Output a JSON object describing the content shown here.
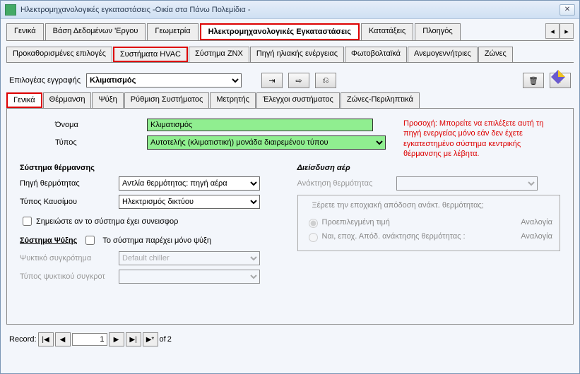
{
  "window": {
    "title": "Ηλεκτρομηχανολογικές εγκαταστάσεις -Οικία στα Πάνω Πολεμίδια -"
  },
  "tabs_main": [
    "Γενικά",
    "Βάση Δεδομένων 'Εργου",
    "Γεωμετρία",
    "Ηλεκτρομηχανολογικές Εγκαταστάσεις",
    "Κατατάξεις",
    "Πλοηγός"
  ],
  "tabs_main_active": 3,
  "tabs_sub": [
    "Προκαθορισμένες επιλογές",
    "Συστήματα HVAC",
    "Σύστημα ZNX",
    "Πηγή ηλιακής ενέργειας",
    "Φωτοβολταϊκά",
    "Ανεμογεννήτριες",
    "Ζώνες"
  ],
  "tabs_sub_active": 1,
  "record_selector": {
    "label": "Επιλογέας εγγραφής",
    "value": "Κλιματισμός"
  },
  "tabs_inner": [
    "Γενικά",
    "Θέρμανση",
    "Ψύξη",
    "Ρύθμιση Συστήματος",
    "Μετρητής",
    "Έλεγχοι συστήματος",
    "Ζώνες-Περιληπτικά"
  ],
  "tabs_inner_active": 0,
  "form": {
    "name_label": "Όνομα",
    "name_value": "Κλιματισμός",
    "type_label": "Τύπος",
    "type_value": "Αυτοτελής (κλιματιστική)  μονάδα διαιρεμένου τύπου"
  },
  "warning": "Προσοχή: Μπορείτε να επιλέξετε αυτή τη πηγή ενεργείας μόνο εάν δεν έχετε εγκατεστημένο σύστημα κεντρικής θέρμανσης με λέβητα.",
  "heating": {
    "section": "Σύστημα θέρμανσης",
    "source_label": "Πηγή θερμότητας",
    "source_value": "Αντλία θερμότητας: πηγή αέρα",
    "fuel_label": "Τύπος Καυσίμου",
    "fuel_value": "Ηλεκτρισμός δικτύου",
    "contrib_check": "Σημειώστε αν το σύστημα έχει συνεισφορ"
  },
  "air": {
    "section": "Διείσδυση αέρ",
    "recovery_label": "Ανάκτηση θερμότητας",
    "fieldset_legend": "Ξέρετε την εποχιακή απόδοση ανάκτ. θερμότητας;",
    "radio1": "Προεπιλεγμένη τιμή",
    "radio2": "Ναι, εποχ. Απόδ. ανάκτησης θερμότητας :",
    "ratio": "Αναλογία"
  },
  "cooling": {
    "section": "Σύστημα Ψύξης",
    "only_cool": "Το σύστημα παρέχει μόνο ψύξη",
    "chiller_label": "Ψυκτικό συγκρότημα",
    "chiller_value": "Default chiller",
    "chiller_type_label": "Τύπος ψυκτικού συγκροτ"
  },
  "nav": {
    "label": "Record:",
    "current": "1",
    "of": "of",
    "total": "2"
  }
}
